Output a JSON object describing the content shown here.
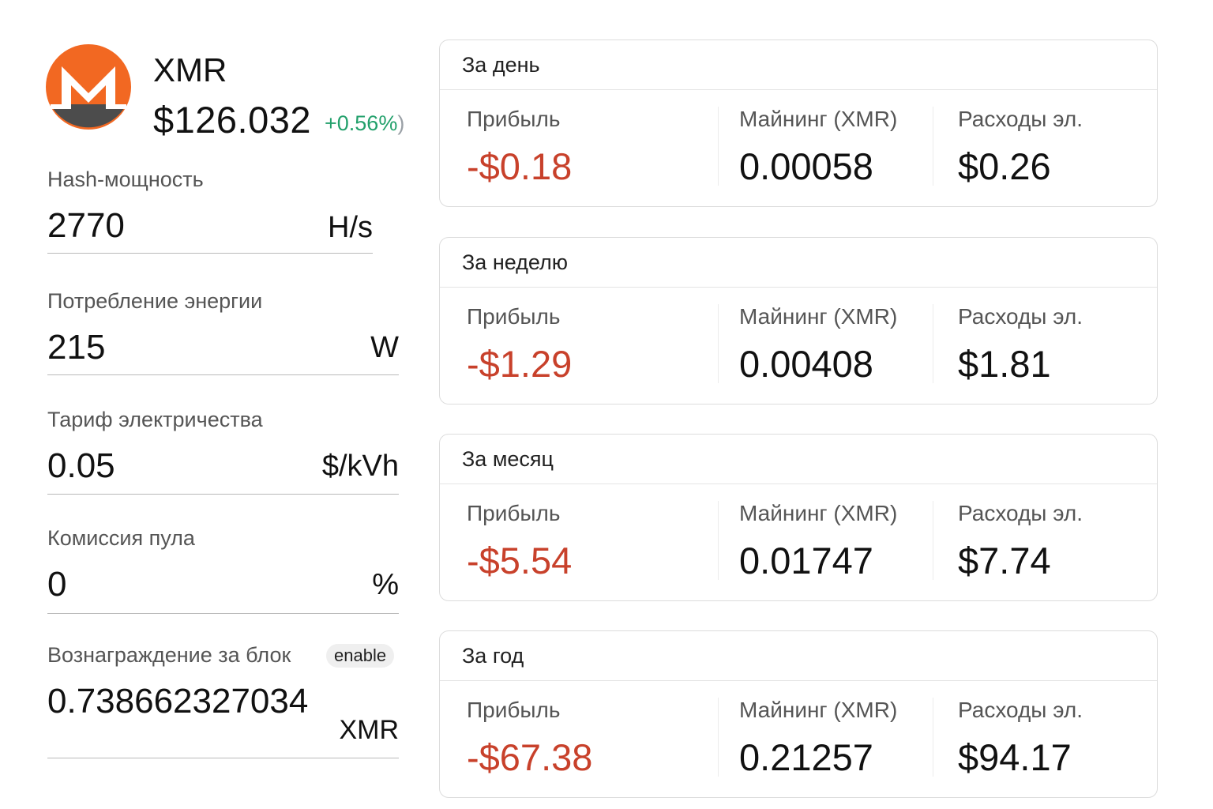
{
  "coin": {
    "symbol": "XMR",
    "price": "$126.032",
    "change": "+0.56%",
    "change_close": ")",
    "logo_icon": "monero-logo-icon",
    "logo_colors": {
      "orange": "#f26822",
      "dark": "#4c4c4c"
    }
  },
  "fields": {
    "hashrate": {
      "label": "Hash-мощность",
      "value": "2770",
      "unit": "H/s"
    },
    "power": {
      "label": "Потребление энергии",
      "value": "215",
      "unit": "W"
    },
    "tariff": {
      "label": "Тариф электричества",
      "value": "0.05",
      "unit": "$/kVh"
    },
    "pool_fee": {
      "label": "Комиссия пула",
      "value": "0",
      "unit": "%"
    },
    "block_reward": {
      "label": "Вознаграждение за блок",
      "badge": "enable",
      "value": "0.738662327034",
      "unit": "XMR"
    }
  },
  "periods": [
    {
      "title": "За день",
      "profit_label": "Прибыль",
      "profit": "-$0.18",
      "mining_label": "Майнинг (XMR)",
      "mining": "0.00058",
      "cost_label": "Расходы эл.",
      "cost": "$0.26"
    },
    {
      "title": "За неделю",
      "profit_label": "Прибыль",
      "profit": "-$1.29",
      "mining_label": "Майнинг (XMR)",
      "mining": "0.00408",
      "cost_label": "Расходы эл.",
      "cost": "$1.81"
    },
    {
      "title": "За месяц",
      "profit_label": "Прибыль",
      "profit": "-$5.54",
      "mining_label": "Майнинг (XMR)",
      "mining": "0.01747",
      "cost_label": "Расходы эл.",
      "cost": "$7.74"
    },
    {
      "title": "За год",
      "profit_label": "Прибыль",
      "profit": "-$67.38",
      "mining_label": "Майнинг (XMR)",
      "mining": "0.21257",
      "cost_label": "Расходы эл.",
      "cost": "$94.17"
    }
  ],
  "colors": {
    "loss": "#c8412b",
    "gain": "#22a06b"
  }
}
